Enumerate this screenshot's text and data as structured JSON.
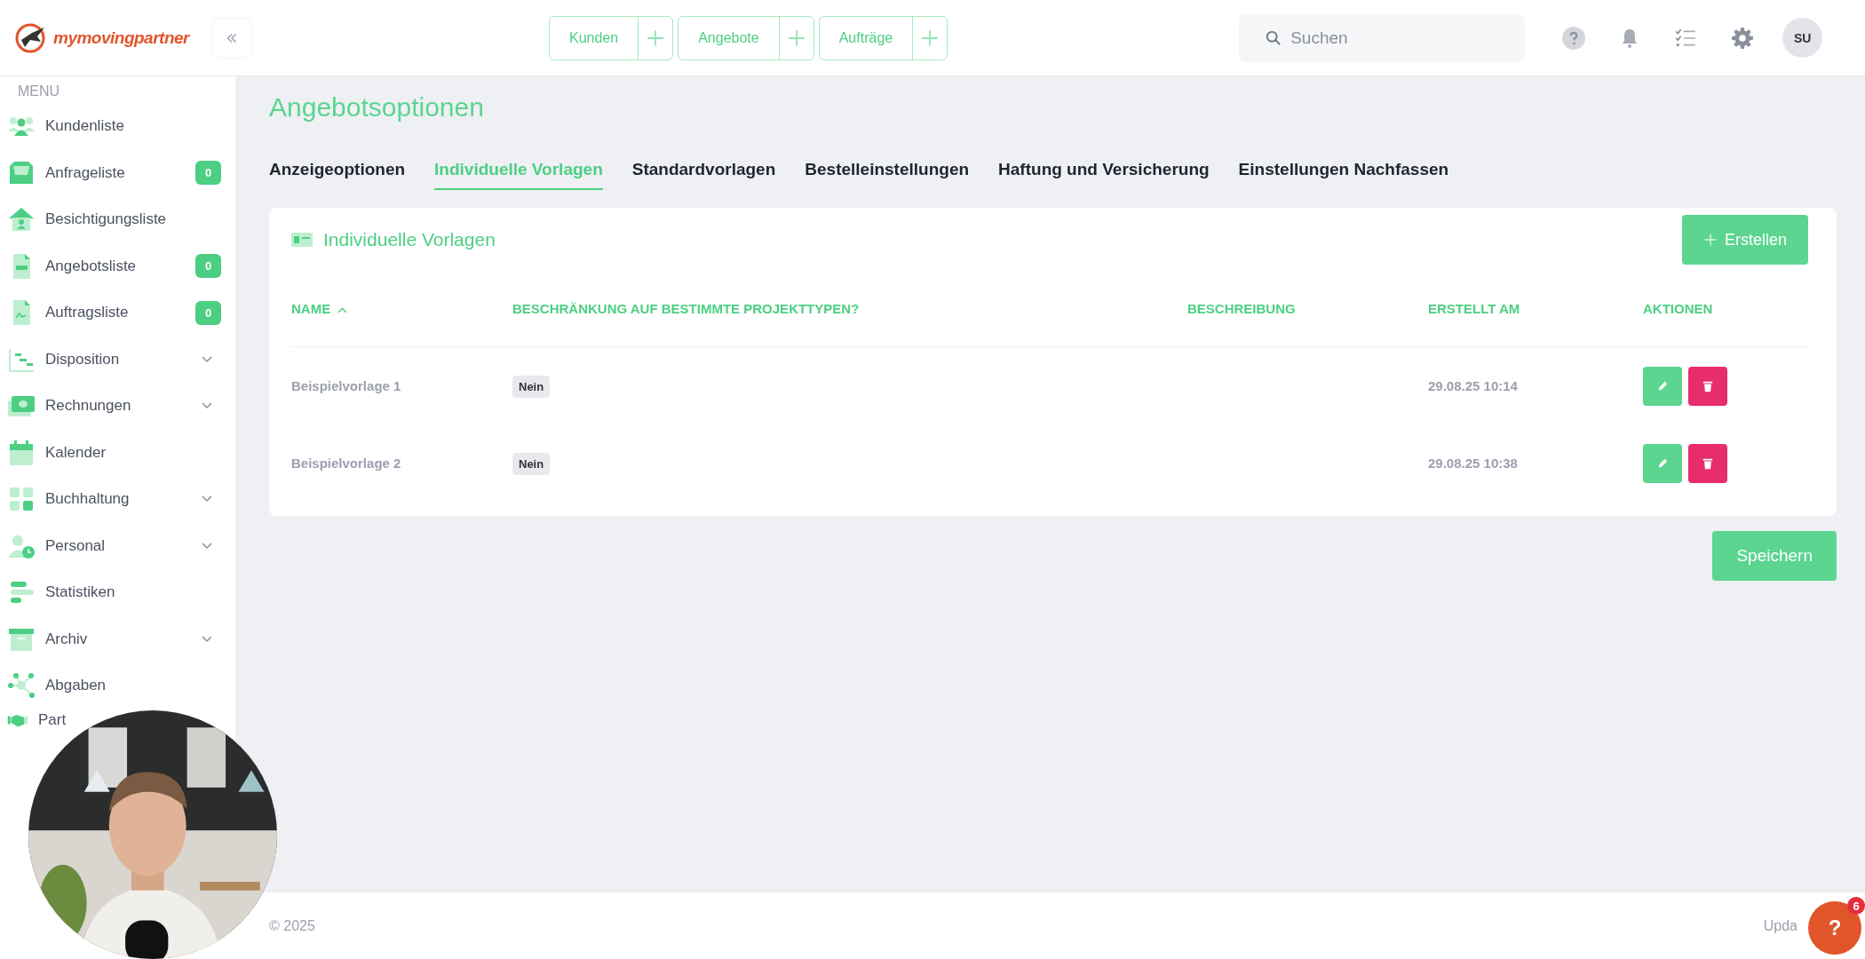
{
  "header": {
    "logo": "mymovingpartner",
    "quick_actions": [
      {
        "label": "Kunden"
      },
      {
        "label": "Angebote"
      },
      {
        "label": "Aufträge"
      }
    ],
    "search": {
      "placeholder": "Suchen"
    },
    "avatar": "SU"
  },
  "sidebar": {
    "heading": "MENU",
    "items": [
      {
        "label": "Kundenliste",
        "expandable": false
      },
      {
        "label": "Anfrageliste",
        "badge": "0",
        "expandable": false
      },
      {
        "label": "Besichtigungsliste",
        "expandable": false
      },
      {
        "label": "Angebotsliste",
        "badge": "0",
        "expandable": false
      },
      {
        "label": "Auftragsliste",
        "badge": "0",
        "expandable": false
      },
      {
        "label": "Disposition",
        "expandable": true
      },
      {
        "label": "Rechnungen",
        "expandable": true
      },
      {
        "label": "Kalender",
        "expandable": false
      },
      {
        "label": "Buchhaltung",
        "expandable": true
      },
      {
        "label": "Personal",
        "expandable": true
      },
      {
        "label": "Statistiken",
        "expandable": false
      },
      {
        "label": "Archiv",
        "expandable": true
      },
      {
        "label": "Abgaben",
        "expandable": false
      },
      {
        "label": "Part",
        "expandable": false
      }
    ]
  },
  "page_title": "Angebotsoptionen",
  "tabs": [
    {
      "label": "Anzeigeoptionen",
      "selected": false
    },
    {
      "label": "Individuelle Vorlagen",
      "selected": true
    },
    {
      "label": "Standardvorlagen",
      "selected": false
    },
    {
      "label": "Bestelleinstellungen",
      "selected": false
    },
    {
      "label": "Haftung und Versicherung",
      "selected": false
    },
    {
      "label": "Einstellungen Nachfassen",
      "selected": false
    }
  ],
  "card": {
    "title": "Individuelle Vorlagen",
    "create_button": "Erstellen",
    "table": {
      "columns": [
        {
          "label": "NAME",
          "sorted": true
        },
        {
          "label": "BESCHRÄNKUNG AUF BESTIMMTE PROJEKTTYPEN?",
          "sorted": false
        },
        {
          "label": "BESCHREIBUNG",
          "sorted": false
        },
        {
          "label": "ERSTELLT AM",
          "sorted": false
        },
        {
          "label": "AKTIONEN",
          "sorted": false
        }
      ],
      "rows": [
        {
          "name": "Beispielvorlage 1",
          "restriction": "Nein",
          "created": "29.08.25 10:14"
        },
        {
          "name": "Beispielvorlage 2",
          "restriction": "Nein",
          "created": "29.08.25 10:38"
        }
      ]
    }
  },
  "save_button": "Speichern",
  "footer": {
    "copyright": "© 2025",
    "right_text": "Upda"
  },
  "help_button": {
    "label": "?",
    "badge": "6"
  }
}
